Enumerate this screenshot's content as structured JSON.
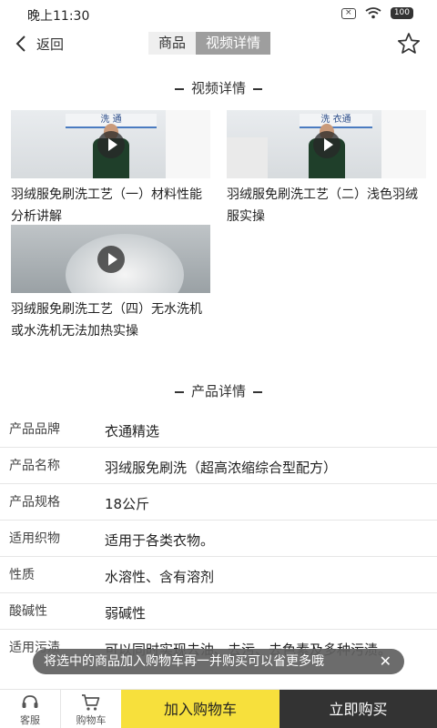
{
  "status_bar": {
    "time": "晚上11:30",
    "battery": "100"
  },
  "nav": {
    "back_label": "返回",
    "tabs": [
      {
        "label": "商品",
        "active": false
      },
      {
        "label": "视频详情",
        "active": true
      }
    ]
  },
  "video_section": {
    "title": "视频详情",
    "videos": [
      {
        "title": "羽绒服免刷洗工艺（一）材料性能分析讲解",
        "thumb_text": "洗  通"
      },
      {
        "title": "羽绒服免刷洗工艺（二）浅色羽绒服实操",
        "thumb_text": "洗  衣通"
      },
      {
        "title": "羽绒服免刷洗工艺（四）无水洗机或水洗机无法加热实操",
        "thumb_text": ""
      }
    ]
  },
  "product_section": {
    "title": "产品详情",
    "rows": [
      {
        "key": "产品品牌",
        "value": "衣通精选"
      },
      {
        "key": "产品名称",
        "value": "羽绒服免刷洗（超高浓缩综合型配方）"
      },
      {
        "key": "产品规格",
        "value": "18公斤"
      },
      {
        "key": "适用织物",
        "value": "适用于各类衣物。"
      },
      {
        "key": "性质",
        "value": "水溶性、含有溶剂"
      },
      {
        "key": "酸碱性",
        "value": "弱碱性"
      },
      {
        "key": "适用污渍",
        "value": "可以同时实现去油、去污、去色素及多种污渍。"
      }
    ]
  },
  "toast": {
    "text": "将选中的商品加入购物车再一并购买可以省更多哦",
    "close": "✕"
  },
  "bottom_bar": {
    "service_label": "客服",
    "cart_label": "购物车",
    "add_to_cart": "加入购物车",
    "buy_now": "立即购买"
  },
  "colors": {
    "accent_yellow": "#f7e03c",
    "buy_dark": "#333333",
    "tab_active": "#9e9e9e"
  }
}
